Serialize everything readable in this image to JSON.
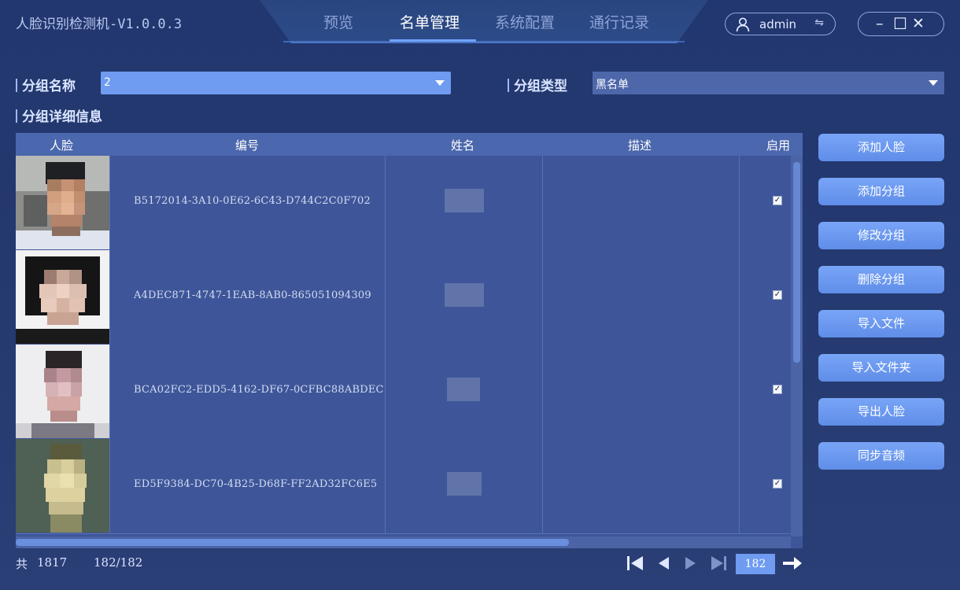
{
  "app": {
    "title": "人脸识别检测机-V1.0.0.3"
  },
  "nav": {
    "tabs": [
      "预览",
      "名单管理",
      "系统配置",
      "通行记录"
    ],
    "active": "名单管理"
  },
  "user": {
    "name": "admin",
    "swap_symbol": "⇋"
  },
  "window_controls": {
    "minimize": "–",
    "maximize": "☐",
    "close": "✕"
  },
  "group": {
    "name_label": "分组名称",
    "name_value": "2",
    "type_label": "分组类型",
    "type_value": "黑名单",
    "details_label": "分组详细信息"
  },
  "table": {
    "headers": [
      "人脸",
      "编号",
      "姓名",
      "描述",
      "启用"
    ],
    "rows": [
      {
        "code": "B5172014-3A10-0E62-6C43-D744C2C0F702",
        "enabled": "✓"
      },
      {
        "code": "A4DEC871-4747-1EAB-8AB0-865051094309",
        "enabled": "✓"
      },
      {
        "code": "BCA02FC2-EDD5-4162-DF67-0CFBC88ABDEC",
        "enabled": "✓"
      },
      {
        "code": "ED5F9384-DC70-4B25-D68F-FF2AD32FC6E5",
        "enabled": "✓"
      }
    ]
  },
  "actions": [
    "添加人脸",
    "添加分组",
    "修改分组",
    "删除分组",
    "导入文件",
    "导入文件夹",
    "导出人脸",
    "同步音频"
  ],
  "footer": {
    "total_label": "共",
    "total_value": "1817",
    "page_info": "182/182",
    "page_input": "182"
  },
  "colors": {
    "accent": "#6f9bf1",
    "background": "#22376f",
    "table": "#3e5699"
  }
}
